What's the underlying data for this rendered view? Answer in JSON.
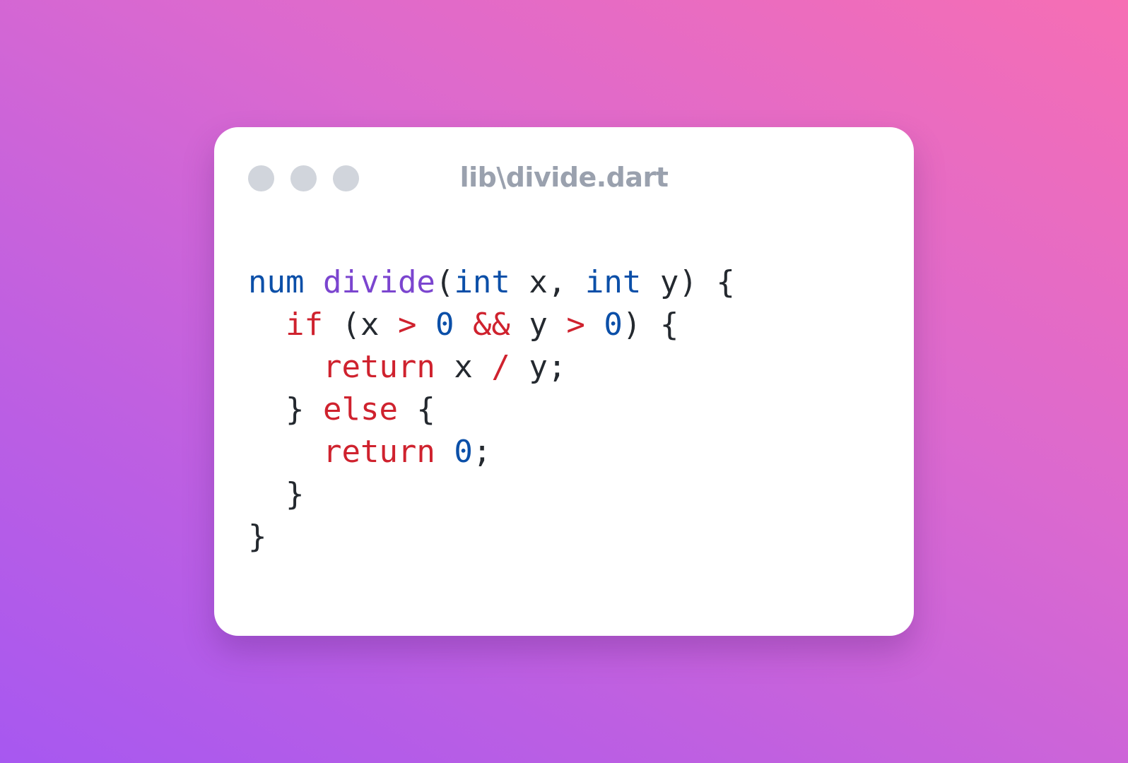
{
  "window": {
    "filename": "lib\\divide.dart",
    "controls": [
      "close-dot",
      "minimize-dot",
      "maximize-dot"
    ]
  },
  "code": {
    "language": "dart",
    "lines": [
      [
        {
          "t": "num",
          "k": "type"
        },
        {
          "t": " ",
          "k": "plain"
        },
        {
          "t": "divide",
          "k": "fn"
        },
        {
          "t": "(",
          "k": "plain"
        },
        {
          "t": "int",
          "k": "type"
        },
        {
          "t": " x, ",
          "k": "plain"
        },
        {
          "t": "int",
          "k": "type"
        },
        {
          "t": " y) {",
          "k": "plain"
        }
      ],
      [
        {
          "t": "  ",
          "k": "plain"
        },
        {
          "t": "if",
          "k": "kw"
        },
        {
          "t": " (x ",
          "k": "plain"
        },
        {
          "t": ">",
          "k": "op"
        },
        {
          "t": " ",
          "k": "plain"
        },
        {
          "t": "0",
          "k": "num"
        },
        {
          "t": " ",
          "k": "plain"
        },
        {
          "t": "&&",
          "k": "op"
        },
        {
          "t": " y ",
          "k": "plain"
        },
        {
          "t": ">",
          "k": "op"
        },
        {
          "t": " ",
          "k": "plain"
        },
        {
          "t": "0",
          "k": "num"
        },
        {
          "t": ") {",
          "k": "plain"
        }
      ],
      [
        {
          "t": "    ",
          "k": "plain"
        },
        {
          "t": "return",
          "k": "kw"
        },
        {
          "t": " x ",
          "k": "plain"
        },
        {
          "t": "/",
          "k": "op"
        },
        {
          "t": " y;",
          "k": "plain"
        }
      ],
      [
        {
          "t": "  } ",
          "k": "plain"
        },
        {
          "t": "else",
          "k": "kw"
        },
        {
          "t": " {",
          "k": "plain"
        }
      ],
      [
        {
          "t": "    ",
          "k": "plain"
        },
        {
          "t": "return",
          "k": "kw"
        },
        {
          "t": " ",
          "k": "plain"
        },
        {
          "t": "0",
          "k": "num"
        },
        {
          "t": ";",
          "k": "plain"
        }
      ],
      [
        {
          "t": "  }",
          "k": "plain"
        }
      ],
      [
        {
          "t": "}",
          "k": "plain"
        }
      ]
    ]
  },
  "colors": {
    "keyword": "#cf222e",
    "type": "#0b4fa8",
    "function": "#7b45cf",
    "number": "#0b4fa8",
    "plain": "#24292f",
    "filename": "#9aa1ae",
    "window_dot": "#d1d5dc",
    "window_bg": "#ffffff",
    "background_gradient": [
      "#f66eb4",
      "#a758f0"
    ]
  }
}
